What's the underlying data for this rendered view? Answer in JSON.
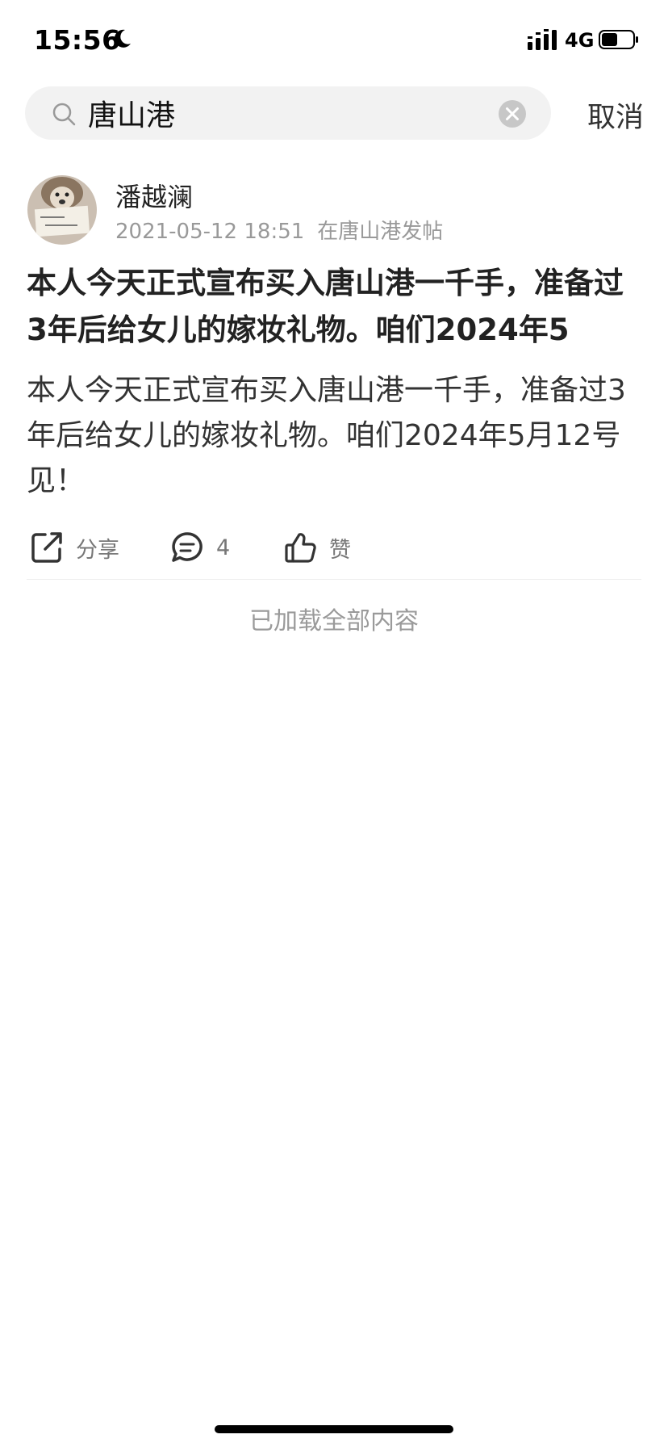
{
  "status_bar": {
    "time": "15:56",
    "network": "4G",
    "icons": [
      "moon-icon",
      "signal-icon",
      "battery-icon"
    ]
  },
  "search": {
    "query": "唐山港",
    "cancel_label": "取消",
    "icons": [
      "search-icon",
      "clear-icon"
    ]
  },
  "post": {
    "author": "潘越澜",
    "date": "2021-05-12 18:51",
    "location": "在唐山港发帖",
    "title": "本人今天正式宣布买入唐山港一千手，准备过3年后给女儿的嫁妆礼物。咱们2024年5",
    "body": "本人今天正式宣布买入唐山港一千手，准备过3年后给女儿的嫁妆礼物。咱们2024年5月12号见！",
    "actions": {
      "share_label": "分享",
      "comment_count": "4",
      "like_label": "赞"
    }
  },
  "footer": {
    "loaded_all": "已加载全部内容"
  },
  "colors": {
    "search_bg": "#f2f2f2",
    "meta_gray": "#999999",
    "text_dark": "#222222"
  }
}
